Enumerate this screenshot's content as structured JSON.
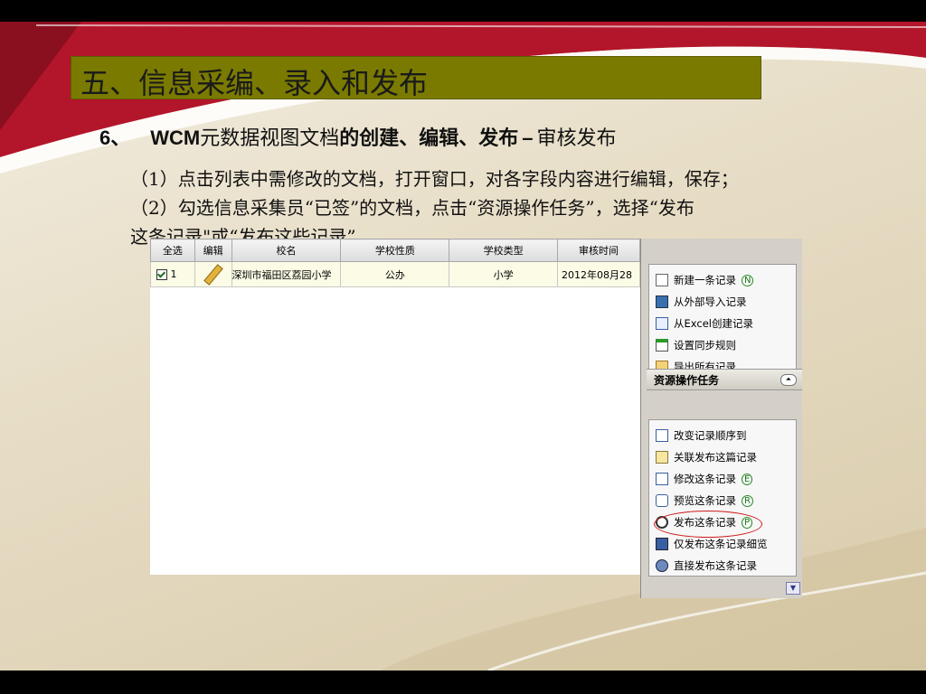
{
  "slide": {
    "title": "五、信息采编、录入和发布",
    "subtitle": {
      "number": "6、",
      "wcm": "WCM",
      "part1": "元数据视图文档",
      "part2": "的创建、编辑、发布",
      "dash": "–",
      "part3": "审核发布"
    },
    "paragraphs": [
      "（1）点击列表中需修改的文档，打开窗口，对各字段内容进行编辑，保存；",
      "（2）勾选信息采集员“已签”的文档，点击“资源操作任务”，选择“发布",
      "这条记录\"或“发布这些记录”。"
    ]
  },
  "table": {
    "headers": [
      "全选",
      "编辑",
      "校名",
      "学校性质",
      "学校类型",
      "审核时间"
    ],
    "rows": [
      {
        "index": "1",
        "checked": true,
        "school": "深圳市福田区荔园小学",
        "nature": "公办",
        "type": "小学",
        "time": "2012年08月28"
      }
    ]
  },
  "panel": {
    "top_items": [
      {
        "label": "新建一条记录",
        "hotkey": "N",
        "icon": "new-document-icon"
      },
      {
        "label": "从外部导入记录",
        "hotkey": "",
        "icon": "import-icon"
      },
      {
        "label": "从Excel创建记录",
        "hotkey": "",
        "icon": "excel-icon"
      },
      {
        "label": "设置同步规则",
        "hotkey": "",
        "icon": "sync-rule-icon"
      },
      {
        "label": "导出所有记录",
        "hotkey": "",
        "icon": "export-icon"
      }
    ],
    "section_title": "资源操作任务",
    "task_items": [
      {
        "label": "改变记录顺序到",
        "hotkey": "",
        "icon": "reorder-icon"
      },
      {
        "label": "关联发布这篇记录",
        "hotkey": "",
        "icon": "link-publish-icon"
      },
      {
        "label": "修改这条记录",
        "hotkey": "E",
        "icon": "edit-icon"
      },
      {
        "label": "预览这条记录",
        "hotkey": "R",
        "icon": "preview-icon"
      },
      {
        "label": "发布这条记录",
        "hotkey": "P",
        "icon": "publish-icon"
      },
      {
        "label": "仅发布这条记录细览",
        "hotkey": "",
        "icon": "publish-detail-icon"
      },
      {
        "label": "直接发布这条记录",
        "hotkey": "",
        "icon": "direct-publish-icon"
      }
    ],
    "collapse_glyph": "⏶",
    "scroll_glyph": "▼"
  },
  "colors": {
    "title_bar": "#7a7a00",
    "accent_red": "#b0182a",
    "highlight_oval": "#d01818"
  }
}
